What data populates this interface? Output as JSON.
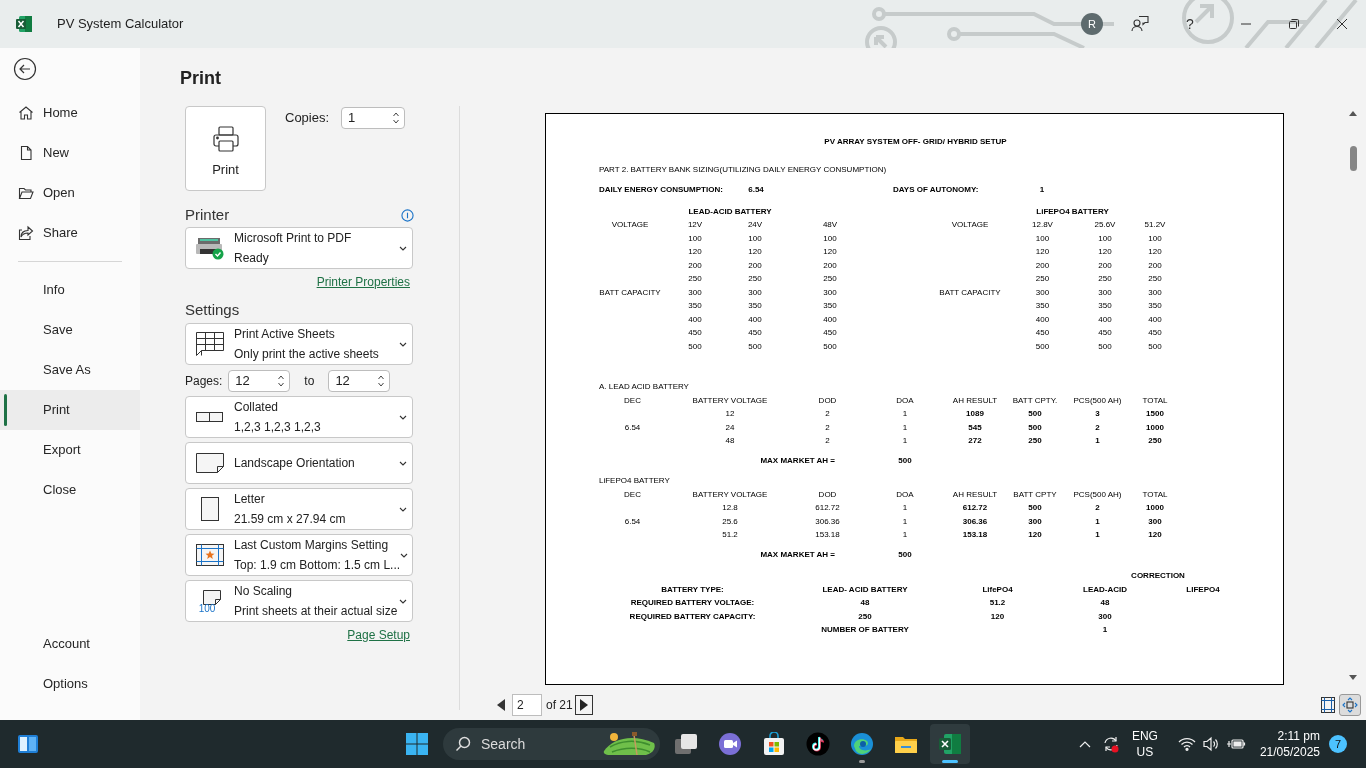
{
  "window": {
    "title": "PV System Calculator",
    "avatar": "R",
    "help": "?"
  },
  "nav": {
    "groups": [
      {
        "items": [
          {
            "label": "Home",
            "selected": false
          },
          {
            "label": "New",
            "selected": false
          },
          {
            "label": "Open",
            "selected": false
          },
          {
            "label": "Share",
            "selected": false
          }
        ]
      },
      {
        "items": [
          {
            "label": "Info",
            "selected": false
          },
          {
            "label": "Save",
            "selected": false
          },
          {
            "label": "Save As",
            "selected": false
          },
          {
            "label": "Print",
            "selected": true
          },
          {
            "label": "Export",
            "selected": false
          },
          {
            "label": "Close",
            "selected": false
          }
        ]
      },
      {
        "items": [
          {
            "label": "Account",
            "selected": false
          },
          {
            "label": "Options",
            "selected": false
          }
        ]
      }
    ]
  },
  "print_panel": {
    "title": "Print",
    "print_button": "Print",
    "copies_label": "Copies:",
    "copies": "1",
    "printer_heading": "Printer",
    "printer": {
      "name": "Microsoft Print to PDF",
      "status": "Ready"
    },
    "printer_properties": "Printer Properties",
    "settings_heading": "Settings",
    "settings": [
      {
        "kind": "sheets",
        "title": "Print Active Sheets",
        "subtitle": "Only print the active sheets"
      },
      {
        "kind": "pages",
        "label": "Pages:",
        "from": "12",
        "to_label": "to",
        "to": "12"
      },
      {
        "kind": "collation",
        "title": "Collated",
        "subtitle": "1,2,3 1,2,3 1,2,3"
      },
      {
        "kind": "orientation",
        "title": "Landscape Orientation"
      },
      {
        "kind": "paper",
        "title": "Letter",
        "subtitle": "21.59 cm x 27.94 cm"
      },
      {
        "kind": "margins",
        "title": "Last Custom Margins Setting",
        "subtitle": "Top: 1.9 cm Bottom: 1.5 cm L..."
      },
      {
        "kind": "scaling",
        "icon_label": "100",
        "title": "No Scaling",
        "subtitle": "Print sheets at their actual size"
      }
    ],
    "page_setup": "Page Setup"
  },
  "preview": {
    "title": "PV ARRAY SYSTEM OFF- GRID/ HYBRID SETUP",
    "part_heading": "PART 2. BATTERY BANK SIZING(UTILIZING DAILY ENERGY CONSUMPTION)",
    "daily_energy": {
      "label": "DAILY ENERGY CONSUMPTION:",
      "value": "6.54"
    },
    "autonomy": {
      "label": "DAYS OF AUTONOMY:",
      "value": "1"
    },
    "options": [
      {
        "heading": "LEAD-ACID BATTERY",
        "voltage_label": "VOLTAGE",
        "voltages": [
          "12V",
          "24V",
          "48V"
        ],
        "capacity_label": "BATT CAPACITY",
        "capacities": [
          [
            "100",
            "100",
            "100"
          ],
          [
            "120",
            "120",
            "120"
          ],
          [
            "200",
            "200",
            "200"
          ],
          [
            "250",
            "250",
            "250"
          ],
          [
            "300",
            "300",
            "300"
          ],
          [
            "350",
            "350",
            "350"
          ],
          [
            "400",
            "400",
            "400"
          ],
          [
            "450",
            "450",
            "450"
          ],
          [
            "500",
            "500",
            "500"
          ]
        ]
      },
      {
        "heading": "LiFEPO4 BATTERY",
        "voltage_label": "VOLTAGE",
        "voltages": [
          "12.8V",
          "25.6V",
          "51.2V"
        ],
        "capacity_label": "BATT CAPACITY",
        "capacities": [
          [
            "100",
            "100",
            "100"
          ],
          [
            "120",
            "120",
            "120"
          ],
          [
            "200",
            "200",
            "200"
          ],
          [
            "250",
            "250",
            "250"
          ],
          [
            "300",
            "300",
            "300"
          ],
          [
            "350",
            "350",
            "350"
          ],
          [
            "400",
            "400",
            "400"
          ],
          [
            "450",
            "450",
            "450"
          ],
          [
            "500",
            "500",
            "500"
          ]
        ]
      }
    ],
    "sections": [
      {
        "heading": "A. LEAD ACID BATTERY",
        "columns": [
          "DEC",
          "BATTERY VOLTAGE",
          "DOD",
          "DOA",
          "AH RESULT",
          "BATT CPTY.",
          "PCS(500 AH)",
          "TOTAL"
        ],
        "rows": [
          [
            "",
            "12",
            "2",
            "1",
            "1089",
            "500",
            "3",
            "1500"
          ],
          [
            "6.54",
            "24",
            "2",
            "1",
            "545",
            "500",
            "2",
            "1000"
          ],
          [
            "",
            "48",
            "2",
            "1",
            "272",
            "250",
            "1",
            "250"
          ]
        ],
        "max_label": "MAX MARKET AH =",
        "max_value": "500"
      },
      {
        "heading": "LiFEPO4 BATTERY",
        "columns": [
          "DEC",
          "BATTERY VOLTAGE",
          "DOD",
          "DOA",
          "AH RESULT",
          "BATT CPTY",
          "PCS(500 AH)",
          "TOTAL"
        ],
        "rows": [
          [
            "",
            "12.8",
            "612.72",
            "1",
            "612.72",
            "500",
            "2",
            "1000"
          ],
          [
            "6.54",
            "25.6",
            "306.36",
            "1",
            "306.36",
            "300",
            "1",
            "300"
          ],
          [
            "",
            "51.2",
            "153.18",
            "1",
            "153.18",
            "120",
            "1",
            "120"
          ]
        ],
        "max_label": "MAX MARKET AH =",
        "max_value": "500"
      }
    ],
    "summary": {
      "correction": "CORRECTION",
      "rows": [
        {
          "kind": "values",
          "label": "BATTERY TYPE:",
          "values": [
            "LEAD- ACID BATTERY",
            "LifePO4",
            "LEAD-ACID",
            "LIFEPO4"
          ]
        },
        {
          "kind": "values",
          "label": "REQUIRED BATTERY VOLTAGE:",
          "values": [
            "48",
            "51.2",
            "48"
          ]
        },
        {
          "kind": "values",
          "label": "REQUIRED BATTERY CAPACITY:",
          "values": [
            "250",
            "120",
            "300"
          ]
        },
        {
          "kind": "count",
          "label": "NUMBER OF BATTERY",
          "value": "1"
        }
      ]
    }
  },
  "pager": {
    "page": "2",
    "total": "of 21"
  },
  "view_buttons": [
    {
      "kind": "margins",
      "selected": false
    },
    {
      "kind": "zoom",
      "selected": true
    }
  ],
  "taskbar": {
    "search": "Search",
    "apps": [
      {
        "kind": "task-view",
        "running": false,
        "selected": false
      },
      {
        "kind": "meet",
        "running": false,
        "selected": false
      },
      {
        "kind": "store",
        "running": false,
        "selected": false
      },
      {
        "kind": "tiktok",
        "running": false,
        "selected": false
      },
      {
        "kind": "edge",
        "running": true,
        "selected": false
      },
      {
        "kind": "explorer",
        "running": false,
        "selected": false
      },
      {
        "kind": "excel",
        "running": true,
        "selected": true
      }
    ],
    "language": "ENG",
    "region": "US",
    "time": "2:11 pm",
    "date": "21/05/2025",
    "notifications": "7"
  }
}
